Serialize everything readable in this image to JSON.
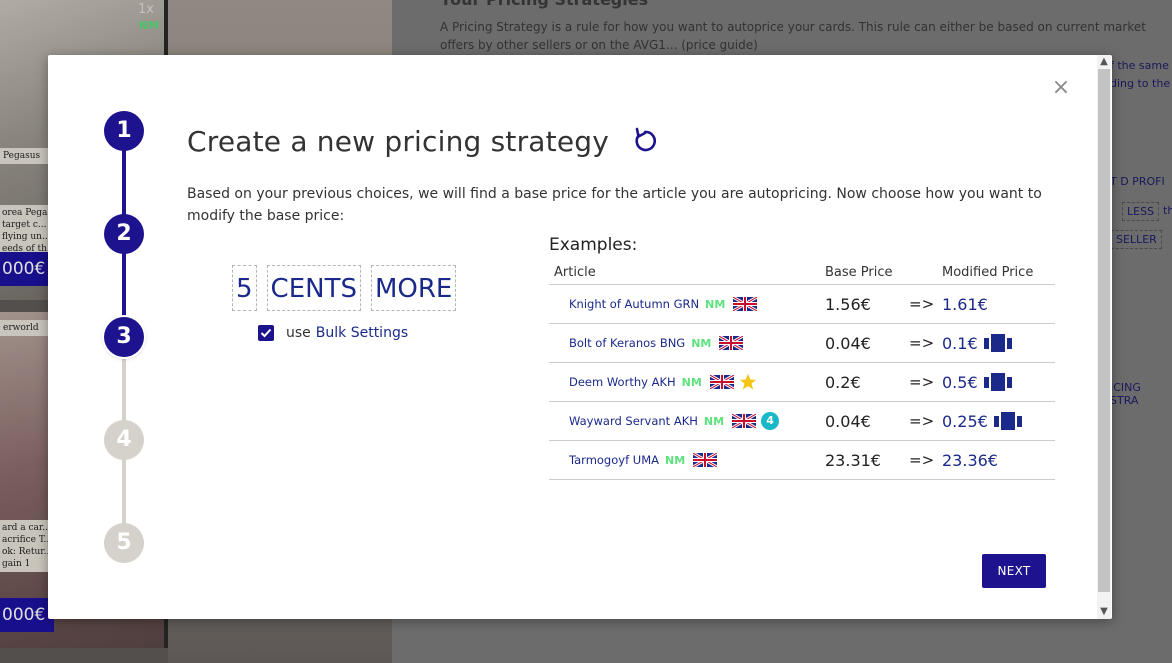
{
  "background": {
    "section_title": "Your Pricing Strategies",
    "intro_text": "A Pricing Strategy is a rule for how you want to autoprice your cards. This rule can either be based on current market offers by other sellers or on the AVG1... (price guide)",
    "side_fragments": [
      "f the same",
      "ding to the",
      "T D PROFI",
      "LESS",
      "th",
      "SELLER",
      "ICING STRA"
    ],
    "card1": {
      "quantity": "1x",
      "condition": "NM",
      "name": "Pegasus",
      "text": "orea Pega... target c... flying un... eeds of th",
      "price": "000€"
    },
    "card2": {
      "name": "erworld",
      "text": "ard a car... acrifice T... ok: Retur... gain 1",
      "price": "000€"
    }
  },
  "modal": {
    "close_label": "×",
    "steps": [
      "1",
      "2",
      "3",
      "4",
      "5"
    ],
    "current_step": 3,
    "title": "Create a new pricing strategy",
    "description": "Based on your previous choices, we will find a base price for the article you are autopricing. Now choose how you want to modify the base price:",
    "modifier": {
      "amount": "5",
      "unit": "CENTS",
      "direction": "MORE"
    },
    "bulk": {
      "checked": true,
      "prefix": "use",
      "link": "Bulk Settings"
    },
    "examples": {
      "title": "Examples:",
      "headers": {
        "article": "Article",
        "base": "Base Price",
        "modified": "Modified Price"
      },
      "rows": [
        {
          "article": "Knight of Autumn GRN",
          "condition": "NM",
          "language": "English",
          "base": "1.56€",
          "arrow": "=>",
          "modified": "1.61€"
        },
        {
          "article": "Bolt of Keranos BNG",
          "condition": "NM",
          "language": "English",
          "base": "0.04€",
          "arrow": "=>",
          "modified": "0.1€"
        },
        {
          "article": "Deem Worthy AKH",
          "condition": "NM",
          "language": "English",
          "base": "0.2€",
          "arrow": "=>",
          "modified": "0.5€"
        },
        {
          "article": "Wayward Servant AKH",
          "condition": "NM",
          "language": "English",
          "badge": "4",
          "base": "0.04€",
          "arrow": "=>",
          "modified": "0.25€"
        },
        {
          "article": "Tarmogoyf UMA",
          "condition": "NM",
          "language": "English",
          "base": "23.31€",
          "arrow": "=>",
          "modified": "23.36€"
        }
      ]
    },
    "next_label": "NEXT",
    "colors": {
      "primary": "#1e138e",
      "link": "#1b2a8a",
      "nm": "#5ee27e",
      "inactive_step": "#d5d1cb",
      "badge": "#19b8c8",
      "star": "#f5c518"
    }
  }
}
